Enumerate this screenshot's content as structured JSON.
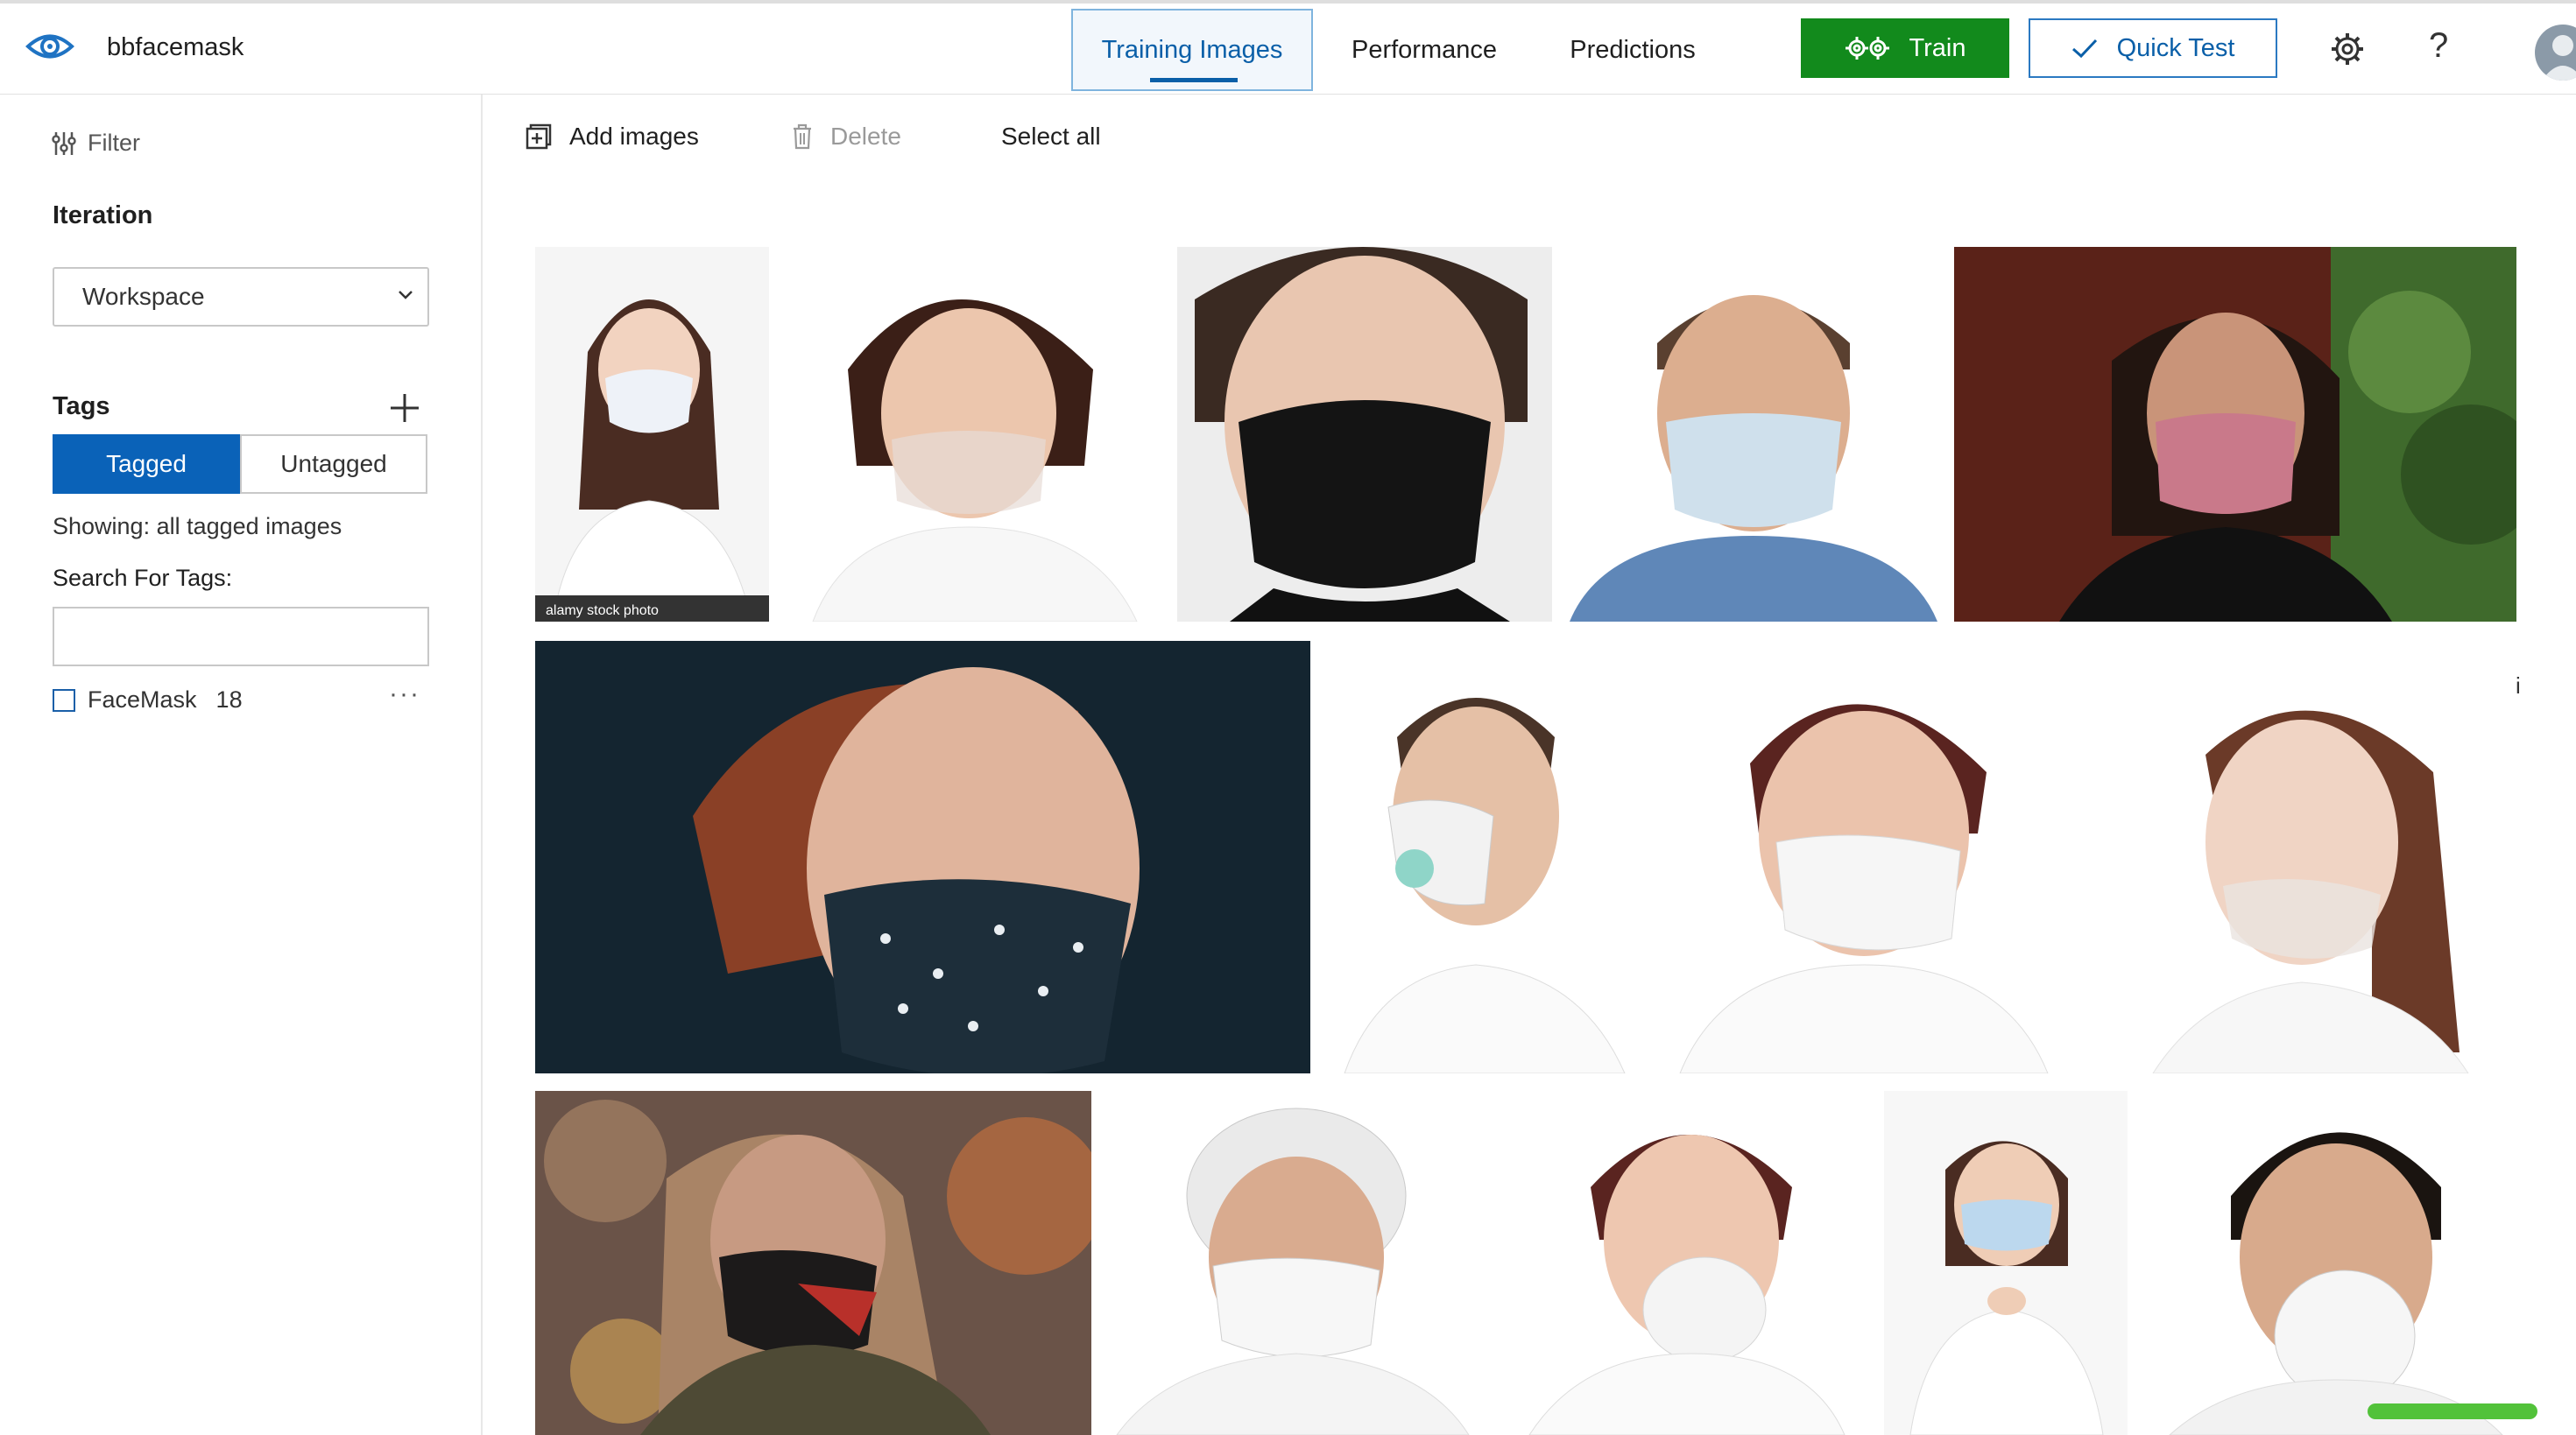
{
  "app": {
    "project_name": "bbfacemask",
    "logo_icon": "eye-icon"
  },
  "nav": {
    "tabs": [
      {
        "label": "Training Images",
        "active": true
      },
      {
        "label": "Performance",
        "active": false
      },
      {
        "label": "Predictions",
        "active": false
      }
    ],
    "train_label": "Train",
    "quick_test_label": "Quick Test"
  },
  "sidebar": {
    "filter_label": "Filter",
    "iteration_title": "Iteration",
    "iteration_value": "Workspace",
    "tags_title": "Tags",
    "tagged_label": "Tagged",
    "untagged_label": "Untagged",
    "showing_text": "Showing: all tagged images",
    "search_label": "Search For Tags:",
    "search_value": "",
    "tag_list": [
      {
        "name": "FaceMask",
        "count": "18",
        "checked": false
      }
    ]
  },
  "toolbar": {
    "add_label": "Add images",
    "delete_label": "Delete",
    "select_all_label": "Select all"
  },
  "grid": {
    "watermark_text": "alamy stock photo",
    "edge_glyph": "i"
  },
  "colors": {
    "accent_blue": "#0a62b8",
    "train_green": "#128a1c",
    "progress_green": "#52c23a"
  }
}
